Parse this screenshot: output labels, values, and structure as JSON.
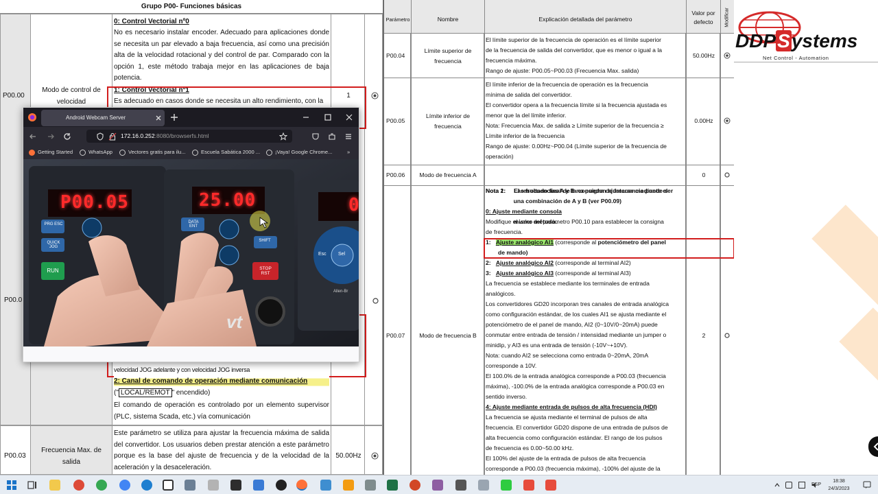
{
  "left_doc": {
    "group_title": "Grupo P00- Funciones básicas",
    "rows": [
      {
        "param": "P00.00",
        "name": "Modo de control de velocidad",
        "value": "1"
      },
      {
        "param": "P00.0",
        "name": "",
        "value": ""
      },
      {
        "param": "P00.03",
        "name": "Frecuencia Max. de salida",
        "value": "50.00Hz"
      }
    ],
    "option0_title": "0: Control Vectorial nº0",
    "option0_text": "No es necesario instalar encoder. Adecuado para aplicaciones donde se necesita un par elevado a baja frecuencia, así como una precisión alta de la velocidad rotacional y del control de par. Comparado con la opción 1, este método trabaja mejor en las aplicaciones de baja potencia.",
    "option1_title": "1: Control Vectorial nº1",
    "option1_text": "Es adecuado en casos donde se necesita un alto rendimiento, con la",
    "jog_text": "velocidad JOG adelante y con velocidad JOG inversa",
    "option2_title": "2: Canal de comando de operación mediante comunicación",
    "option2_local_pre": "(\"",
    "option2_local": "LOCAL/REMOT",
    "option2_local_post": "\" encendido)",
    "option2_text": "El comando de operación es controlado por un elemento supervisor (PLC, sistema Scada, etc.) vía comunicación",
    "p0003_text": "Este parámetro se utiliza para ajustar la frecuencia máxima de salida del convertidor. Los usuarios deben prestar atención a este parámetro porque es la base del ajuste de frecuencia y de la velocidad de la aceleración y la desaceleración."
  },
  "right_doc": {
    "headers": {
      "param": "Parámetro",
      "name": "Nombre",
      "explain": "Explicación detallada del parámetro",
      "default": "Valor por defecto",
      "modify": "Modificar"
    },
    "p0004": {
      "param": "P00.04",
      "name": "Límite superior de frecuencia",
      "default": "50.00Hz",
      "text": [
        "El límite superior de la frecuencia de operación es el límite superior",
        "de la frecuencia de salida del convertidor, que es menor o igual a la",
        "frecuencia máxima.",
        "Rango de ajuste: P00.05~P00.03 (Frecuencia Max. salida)"
      ]
    },
    "p0005": {
      "param": "P00.05",
      "name": "Límite inferior de frecuencia",
      "default": "0.00Hz",
      "text": [
        "El límite inferior de la frecuencia de operación es la frecuencia",
        "mínima de salida del convertidor.",
        "El convertidor opera a la frecuencia límite si la frecuencia ajustada es",
        "menor que la del límite inferior.",
        "Nota: Frecuencia Max. de salida ≥ Límite superior de la frecuencia ≥",
        "Límite inferior de la frecuencia",
        "Rango de ajuste: 0.00Hz~P00.04 (Límite superior de la frecuencia de",
        "operación)"
      ]
    },
    "p0006": {
      "param": "P00.06",
      "name": "Modo de frecuencia A",
      "default": "0",
      "text": [
        "Nota 1:     Las frecuencias A y B no pueden ajustarse mediante el",
        "                 mismo método."
      ]
    },
    "p0007": {
      "param": "P00.07",
      "name": "Modo de frecuencia B",
      "default": "2",
      "nota2": [
        "Nota 2:     El resultado final de la consigna de frecuencia puede ser",
        "                 una combinación de A y B (ver P00.09)"
      ],
      "opt0_title": "0: Ajuste mediante consola",
      "opt0_text": [
        "Modifique el valor del parámetro P00.10 para establecer la consigna",
        "de frecuencia."
      ],
      "opt1_num": "1:",
      "opt1_title": "Ajuste analógico AI1",
      "opt1_rest": " (corresponde al ",
      "opt1_bold": "potenciómetro del panel",
      "opt1_line2": "de mando)",
      "opt2_num": "2:",
      "opt2_title": "Ajuste analógico AI2",
      "opt2_rest": " (corresponde al terminal AI2)",
      "opt3_num": "3:",
      "opt3_title": "Ajuste analógico AI3",
      "opt3_rest": " (corresponde al terminal AI3)",
      "body": [
        "La frecuencia se establece mediante los terminales de entrada",
        "analógicos.",
        "Los convertidores GD20 incorporan tres canales de entrada analógica",
        "como configuración estándar, de los cuales AI1 se ajusta mediante el",
        "potenciómetro de el panel de mando, AI2 (0~10V/0~20mA) puede",
        "conmutar entre entrada de tensión / intensidad mediante un jumper o",
        "minidip, y AI3 es una entrada de tensión (-10V~+10V).",
        "Nota: cuando AI2 se selecciona como entrada 0~20mA, 20mA",
        "corresponde a 10V.",
        "El 100.0% de la entrada analógica corresponde a P00.03 (frecuencia",
        "máxima), -100.0% de la entrada analógica corresponde a P00.03 en",
        "sentido inverso."
      ],
      "opt4_title": "4: Ajuste mediante entrada de pulsos de alta frecuencia (HDI)",
      "body2": [
        "La frecuencia se ajusta mediante el terminal de pulsos de alta",
        "frecuencia. El convertidor GD20 dispone de una entrada de pulsos de",
        "alta frecuencia como configuración estándar. El rango de los pulsos",
        "de frecuencia es 0.00~50.00 kHz.",
        "El 100% del ajuste de la entrada de pulsos de alta frecuencia",
        "corresponde a P00.03 (frecuencia máxima), -100% del ajuste de la"
      ]
    }
  },
  "logo": {
    "brand_prefix": "DDP",
    "brand_s": "S",
    "brand_suffix": "ystems",
    "tagline": "Net Control - Automation"
  },
  "browser": {
    "tab_title": "Android Webcam Server",
    "url_host": "172.16.0.252",
    "url_rest": ":8080/browserfs.html",
    "bookmarks": [
      "Getting Started",
      "WhatsApp",
      "Vectores gratis para ilu...",
      "Escuela Sabática 2000 ...",
      "¡Vaya! Google Chrome..."
    ],
    "video": {
      "left_display": "P00.05",
      "mid_display": "25.00",
      "right_display": "0",
      "brand": "vt",
      "keys": [
        "PRG ESC",
        "DATA ENT",
        "QUICK JOG",
        "SHIFT",
        "RUN",
        "STOP RST",
        "Esc",
        "Sel"
      ],
      "allen": "Allen-Br"
    }
  },
  "taskbar": {
    "lang": "ESP",
    "time": "18:38",
    "date": "24/3/2023"
  },
  "colors": {
    "red_frame": "#d21c1c",
    "highlight": "#9be56c",
    "brand_red": "#d52a2a",
    "led_red": "#ff2a2a"
  }
}
